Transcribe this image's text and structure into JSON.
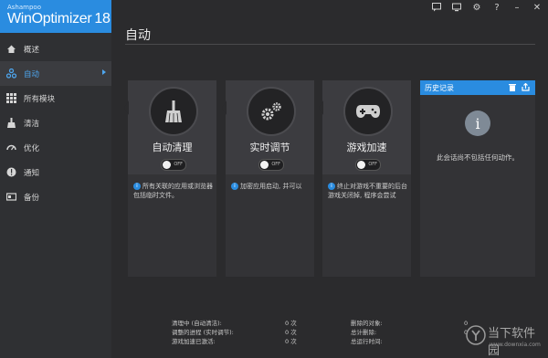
{
  "app": {
    "brand_sub": "Ashampoo",
    "brand_name": "WinOptimizer",
    "version": "18"
  },
  "sidebar": {
    "items": [
      {
        "label": "概述",
        "icon": "home-icon"
      },
      {
        "label": "自动",
        "icon": "auto-icon",
        "active": true
      },
      {
        "label": "所有模块",
        "icon": "grid-icon"
      },
      {
        "label": "清洁",
        "icon": "broom-icon"
      },
      {
        "label": "优化",
        "icon": "gauge-icon"
      },
      {
        "label": "通知",
        "icon": "bell-icon"
      },
      {
        "label": "备份",
        "icon": "backup-icon"
      }
    ]
  },
  "page": {
    "title": "自动"
  },
  "cards": [
    {
      "title": "自动清理",
      "toggle": "OFF",
      "info": "所有关联的应用或浏览器包括临时文件。"
    },
    {
      "title": "实时调节",
      "toggle": "OFF",
      "info": "加密应用启动, 并可以"
    },
    {
      "title": "游戏加速",
      "toggle": "OFF",
      "info": "终止对游戏不重要的后台游戏关闭掉, 程序会尝试"
    }
  ],
  "history": {
    "title": "历史记录",
    "message": "此会话尚不包括任何动作。",
    "info_icon": "i"
  },
  "stats_left": [
    {
      "label": "清理中 (自动清洁):",
      "value": "0 次"
    },
    {
      "label": "调整的进程 (实时调节):",
      "value": "0 次"
    },
    {
      "label": "游戏加速已激活:",
      "value": "0 次"
    }
  ],
  "stats_right": [
    {
      "label": "删除的对象:",
      "value": "0"
    },
    {
      "label": "总计删除:",
      "value": "0"
    },
    {
      "label": "总运行时间:",
      "value": ""
    }
  ],
  "watermark": {
    "text": "当下软件园",
    "url": "www.downxia.com"
  },
  "colors": {
    "accent": "#2a8ce0",
    "sidebar_bg": "#2f3033",
    "content_bg": "#2b2b2d"
  }
}
